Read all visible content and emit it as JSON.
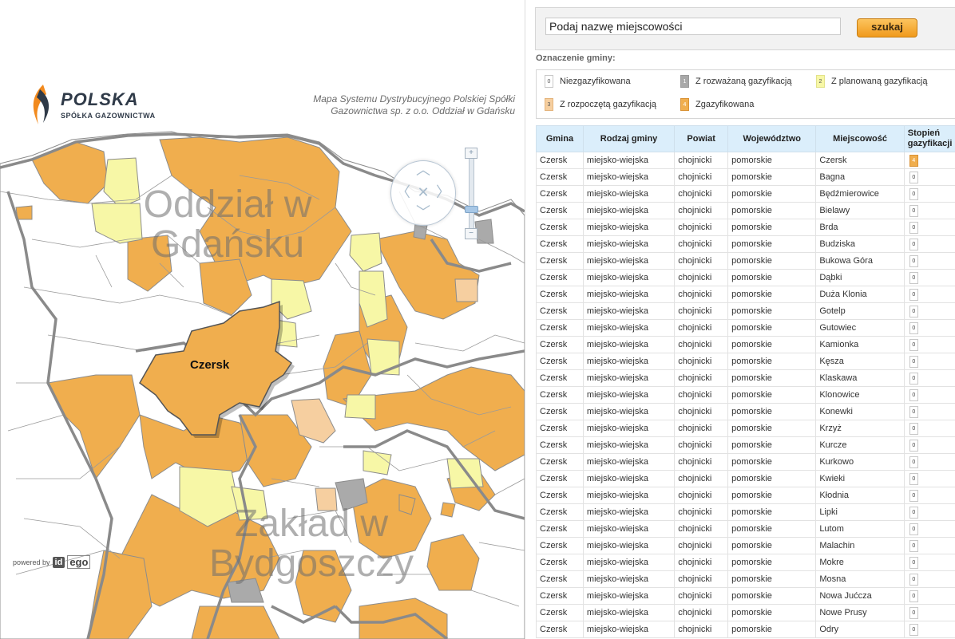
{
  "map": {
    "logo_title": "POLSKA",
    "logo_subtitle": "SPÓŁKA GAZOWNICTWA",
    "caption": "Mapa Systemu Dystrybucyjnego Polskiej Spółki Gazownictwa sp. z o.o. Oddział w Gdańsku",
    "region_label_1": "Oddział w Gdańsku",
    "region_label_2": "Zakład w Bydgoszczy",
    "selected_gmina": "Czersk",
    "powered_by": "powered by",
    "powered_badge_1": "id",
    "powered_badge_2": "ego",
    "nav_icons": [
      "arrow-up-icon",
      "arrow-left-icon",
      "close-icon",
      "arrow-right-icon",
      "arrow-down-icon"
    ],
    "colors": {
      "gazyfikowana": "#f0ae4e",
      "planowana": "#f7f7a6",
      "rozpoczeta": "#f6cfa0",
      "rozwazana": "#aaaaaa",
      "niezgazyfikowana": "#ffffff",
      "boundary": "#8c8c8c"
    }
  },
  "search": {
    "value": "Podaj nazwę miejscowości",
    "button_label": "szukaj"
  },
  "legend": {
    "title": "Oznaczenie gminy:",
    "items": [
      {
        "code": "0",
        "label": "Niezgazyfikowana",
        "color": "#ffffff"
      },
      {
        "code": "1",
        "label": "Z rozważaną gazyfikacją",
        "color": "#a8a8a8"
      },
      {
        "code": "2",
        "label": "Z planowaną gazyfikacją",
        "color": "#f7f7a6"
      },
      {
        "code": "3",
        "label": "Z rozpoczętą gazyfikacją",
        "color": "#f6cfa0"
      },
      {
        "code": "4",
        "label": "Zgazyfikowana",
        "color": "#f0ae4e"
      }
    ]
  },
  "table": {
    "headers": [
      "Gmina",
      "Rodzaj gminy",
      "Powiat",
      "Województwo",
      "Miejscowość",
      "Stopień gazyfikacji"
    ],
    "rows": [
      {
        "gmina": "Czersk",
        "rodzaj": "miejsko-wiejska",
        "powiat": "chojnicki",
        "woj": "pomorskie",
        "miejscowosc": "Czersk",
        "stopien": "4"
      },
      {
        "gmina": "Czersk",
        "rodzaj": "miejsko-wiejska",
        "powiat": "chojnicki",
        "woj": "pomorskie",
        "miejscowosc": "Bagna",
        "stopien": "0"
      },
      {
        "gmina": "Czersk",
        "rodzaj": "miejsko-wiejska",
        "powiat": "chojnicki",
        "woj": "pomorskie",
        "miejscowosc": "Będźmierowice",
        "stopien": "0"
      },
      {
        "gmina": "Czersk",
        "rodzaj": "miejsko-wiejska",
        "powiat": "chojnicki",
        "woj": "pomorskie",
        "miejscowosc": "Bielawy",
        "stopien": "0"
      },
      {
        "gmina": "Czersk",
        "rodzaj": "miejsko-wiejska",
        "powiat": "chojnicki",
        "woj": "pomorskie",
        "miejscowosc": "Brda",
        "stopien": "0"
      },
      {
        "gmina": "Czersk",
        "rodzaj": "miejsko-wiejska",
        "powiat": "chojnicki",
        "woj": "pomorskie",
        "miejscowosc": "Budziska",
        "stopien": "0"
      },
      {
        "gmina": "Czersk",
        "rodzaj": "miejsko-wiejska",
        "powiat": "chojnicki",
        "woj": "pomorskie",
        "miejscowosc": "Bukowa Góra",
        "stopien": "0"
      },
      {
        "gmina": "Czersk",
        "rodzaj": "miejsko-wiejska",
        "powiat": "chojnicki",
        "woj": "pomorskie",
        "miejscowosc": "Dąbki",
        "stopien": "0"
      },
      {
        "gmina": "Czersk",
        "rodzaj": "miejsko-wiejska",
        "powiat": "chojnicki",
        "woj": "pomorskie",
        "miejscowosc": "Duża Klonia",
        "stopien": "0"
      },
      {
        "gmina": "Czersk",
        "rodzaj": "miejsko-wiejska",
        "powiat": "chojnicki",
        "woj": "pomorskie",
        "miejscowosc": "Gotelp",
        "stopien": "0"
      },
      {
        "gmina": "Czersk",
        "rodzaj": "miejsko-wiejska",
        "powiat": "chojnicki",
        "woj": "pomorskie",
        "miejscowosc": "Gutowiec",
        "stopien": "0"
      },
      {
        "gmina": "Czersk",
        "rodzaj": "miejsko-wiejska",
        "powiat": "chojnicki",
        "woj": "pomorskie",
        "miejscowosc": "Kamionka",
        "stopien": "0"
      },
      {
        "gmina": "Czersk",
        "rodzaj": "miejsko-wiejska",
        "powiat": "chojnicki",
        "woj": "pomorskie",
        "miejscowosc": "Kęsza",
        "stopien": "0"
      },
      {
        "gmina": "Czersk",
        "rodzaj": "miejsko-wiejska",
        "powiat": "chojnicki",
        "woj": "pomorskie",
        "miejscowosc": "Klaskawa",
        "stopien": "0"
      },
      {
        "gmina": "Czersk",
        "rodzaj": "miejsko-wiejska",
        "powiat": "chojnicki",
        "woj": "pomorskie",
        "miejscowosc": "Klonowice",
        "stopien": "0"
      },
      {
        "gmina": "Czersk",
        "rodzaj": "miejsko-wiejska",
        "powiat": "chojnicki",
        "woj": "pomorskie",
        "miejscowosc": "Konewki",
        "stopien": "0"
      },
      {
        "gmina": "Czersk",
        "rodzaj": "miejsko-wiejska",
        "powiat": "chojnicki",
        "woj": "pomorskie",
        "miejscowosc": "Krzyż",
        "stopien": "0"
      },
      {
        "gmina": "Czersk",
        "rodzaj": "miejsko-wiejska",
        "powiat": "chojnicki",
        "woj": "pomorskie",
        "miejscowosc": "Kurcze",
        "stopien": "0"
      },
      {
        "gmina": "Czersk",
        "rodzaj": "miejsko-wiejska",
        "powiat": "chojnicki",
        "woj": "pomorskie",
        "miejscowosc": "Kurkowo",
        "stopien": "0"
      },
      {
        "gmina": "Czersk",
        "rodzaj": "miejsko-wiejska",
        "powiat": "chojnicki",
        "woj": "pomorskie",
        "miejscowosc": "Kwieki",
        "stopien": "0"
      },
      {
        "gmina": "Czersk",
        "rodzaj": "miejsko-wiejska",
        "powiat": "chojnicki",
        "woj": "pomorskie",
        "miejscowosc": "Kłodnia",
        "stopien": "0"
      },
      {
        "gmina": "Czersk",
        "rodzaj": "miejsko-wiejska",
        "powiat": "chojnicki",
        "woj": "pomorskie",
        "miejscowosc": "Lipki",
        "stopien": "0"
      },
      {
        "gmina": "Czersk",
        "rodzaj": "miejsko-wiejska",
        "powiat": "chojnicki",
        "woj": "pomorskie",
        "miejscowosc": "Lutom",
        "stopien": "0"
      },
      {
        "gmina": "Czersk",
        "rodzaj": "miejsko-wiejska",
        "powiat": "chojnicki",
        "woj": "pomorskie",
        "miejscowosc": "Malachin",
        "stopien": "0"
      },
      {
        "gmina": "Czersk",
        "rodzaj": "miejsko-wiejska",
        "powiat": "chojnicki",
        "woj": "pomorskie",
        "miejscowosc": "Mokre",
        "stopien": "0"
      },
      {
        "gmina": "Czersk",
        "rodzaj": "miejsko-wiejska",
        "powiat": "chojnicki",
        "woj": "pomorskie",
        "miejscowosc": "Mosna",
        "stopien": "0"
      },
      {
        "gmina": "Czersk",
        "rodzaj": "miejsko-wiejska",
        "powiat": "chojnicki",
        "woj": "pomorskie",
        "miejscowosc": "Nowa Jućcza",
        "stopien": "0"
      },
      {
        "gmina": "Czersk",
        "rodzaj": "miejsko-wiejska",
        "powiat": "chojnicki",
        "woj": "pomorskie",
        "miejscowosc": "Nowe Prusy",
        "stopien": "0"
      },
      {
        "gmina": "Czersk",
        "rodzaj": "miejsko-wiejska",
        "powiat": "chojnicki",
        "woj": "pomorskie",
        "miejscowosc": "Odry",
        "stopien": "0"
      }
    ]
  }
}
